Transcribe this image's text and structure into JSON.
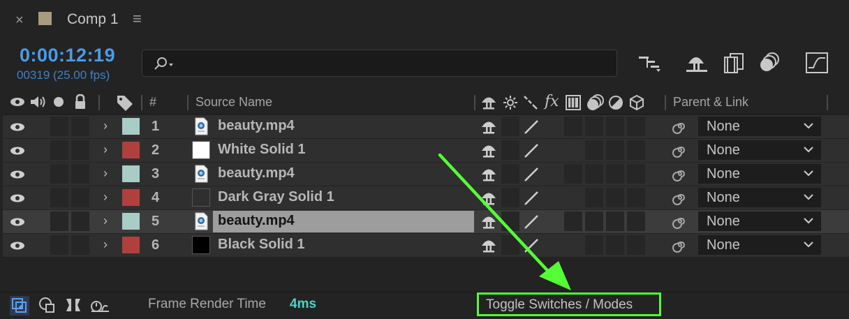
{
  "tab": {
    "close": "×",
    "title": "Comp 1",
    "menu": "≡",
    "swatch_color": "#a99b7e"
  },
  "header": {
    "timecode": "0:00:12:19",
    "frames": "00319 (25.00 fps)",
    "search_value": "",
    "tools": [
      "flowchart-icon",
      "draft-3d-icon",
      "frame-blending-icon",
      "motion-blur-icon",
      "graph-editor-icon"
    ]
  },
  "columns": {
    "number": "#",
    "source_name": "Source Name",
    "fx": "fx",
    "parent_link": "Parent & Link"
  },
  "layers": [
    {
      "num": "1",
      "name": "beauty.mp4",
      "label_color": "#a9cdc6",
      "type": "footage",
      "parent": "None",
      "selected": false
    },
    {
      "num": "2",
      "name": "White Solid 1",
      "label_color": "#b0403e",
      "type": "solid",
      "solid_color": "#ffffff",
      "parent": "None",
      "selected": false
    },
    {
      "num": "3",
      "name": "beauty.mp4",
      "label_color": "#a9cdc6",
      "type": "footage",
      "parent": "None",
      "selected": false
    },
    {
      "num": "4",
      "name": "Dark Gray Solid 1",
      "label_color": "#b0403e",
      "type": "solid",
      "solid_color": "#2f2f2f",
      "parent": "None",
      "selected": false
    },
    {
      "num": "5",
      "name": "beauty.mp4",
      "label_color": "#a9cdc6",
      "type": "footage",
      "parent": "None",
      "selected": true
    },
    {
      "num": "6",
      "name": "Black Solid 1",
      "label_color": "#b0403e",
      "type": "solid",
      "solid_color": "#000000",
      "parent": "None",
      "selected": false
    }
  ],
  "footer": {
    "frame_render_label": "Frame Render Time",
    "frame_render_value": "4ms",
    "toggle_label": "Toggle Switches / Modes"
  },
  "colors": {
    "accent": "#4a9ce8",
    "annotation": "#55ff35",
    "render_time": "#4fd3c8"
  }
}
